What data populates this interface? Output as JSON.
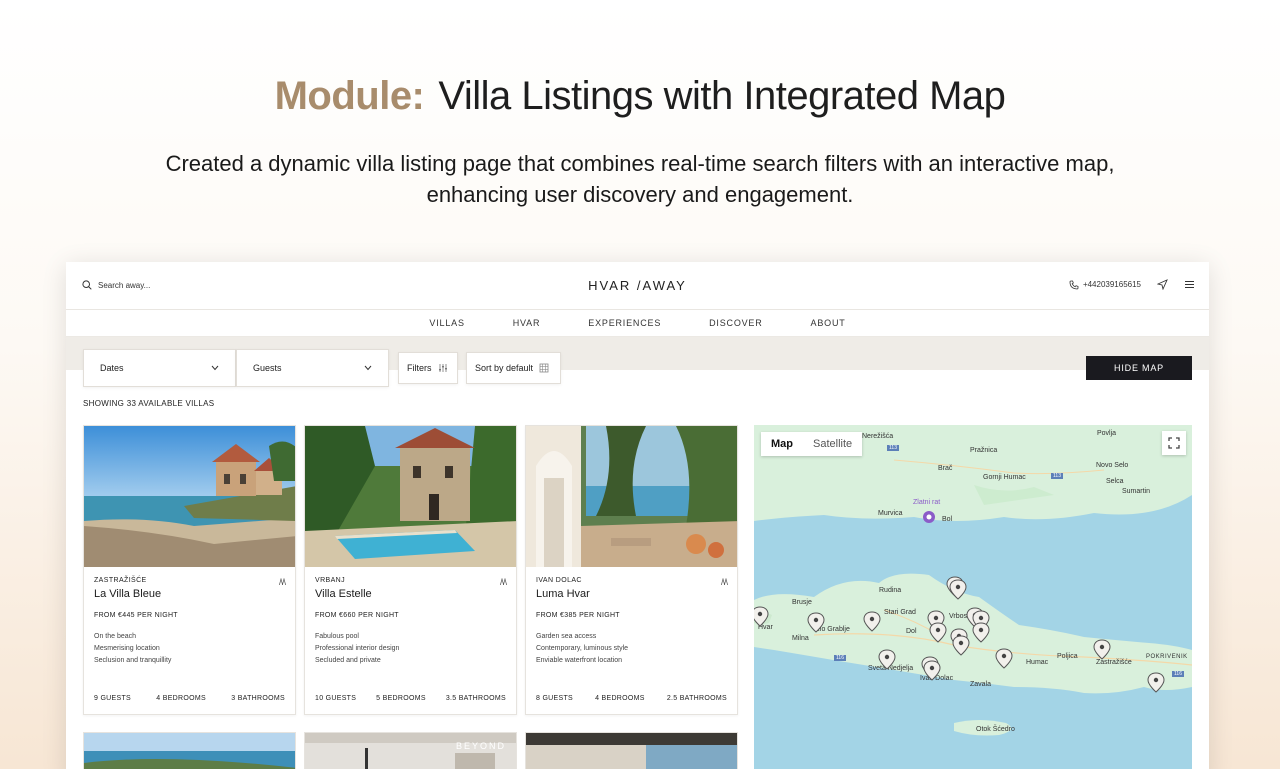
{
  "header": {
    "accent": "Module:",
    "title": "Villa Listings with Integrated Map",
    "description": "Created a dynamic villa listing page that combines real-time search filters with an interactive map, enhancing user discovery and engagement."
  },
  "site": {
    "search_placeholder": "Search away...",
    "logo": "HVAR /AWAY",
    "phone": "+442039165615",
    "nav": [
      "VILLAS",
      "HVAR",
      "EXPERIENCES",
      "DISCOVER",
      "ABOUT"
    ]
  },
  "filters": {
    "dates": "Dates",
    "guests": "Guests",
    "filters": "Filters",
    "sort": "Sort by default",
    "hide_map": "HIDE MAP"
  },
  "results": {
    "showing": "SHOWING 33 AVAILABLE VILLAS"
  },
  "listings": [
    {
      "location": "ZASTRAŽIŠĆE",
      "name": "La Villa Bleue",
      "price": "FROM €445 PER NIGHT",
      "features": [
        "On the beach",
        "Mesmerising location",
        "Seclusion and tranquillity"
      ],
      "guests": "9 GUESTS",
      "bedrooms": "4 BEDROOMS",
      "bathrooms": "3 BATHROOMS"
    },
    {
      "location": "VRBANJ",
      "name": "Villa Estelle",
      "price": "FROM €660 PER NIGHT",
      "features": [
        "Fabulous pool",
        "Professional interior design",
        "Secluded and private"
      ],
      "guests": "10 GUESTS",
      "bedrooms": "5 BEDROOMS",
      "bathrooms": "3.5 BATHROOMS"
    },
    {
      "location": "IVAN DOLAC",
      "name": "Luma Hvar",
      "price": "FROM €385 PER NIGHT",
      "features": [
        "Garden sea access",
        "Contemporary, luminous style",
        "Enviable waterfront location"
      ],
      "guests": "8 GUESTS",
      "bedrooms": "4 BEDROOMS",
      "bathrooms": "2.5 BATHROOMS"
    }
  ],
  "second_row": {
    "brand_overlay": "BEYOND"
  },
  "map": {
    "tab_map": "Map",
    "tab_satellite": "Satellite",
    "labels": {
      "nerezisca": "Nerežišća",
      "povlja": "Povlja",
      "praznica": "Pražnica",
      "brac": "Brač",
      "gornji_humac": "Gornji Humac",
      "novo_selo": "Novo Selo",
      "selca": "Selca",
      "sumartin": "Sumartin",
      "zlatni_rat": "Zlatni rat",
      "murvica": "Murvica",
      "bol": "Bol",
      "rudina": "Rudina",
      "brusje": "Brusje",
      "stari_grad": "Stari Grad",
      "vrboska": "Vrbos...",
      "hvar": "Hvar",
      "velo_grablje": "elo Grablje",
      "milna": "Milna",
      "dol": "Dol",
      "sveta_nedjelja": "Sveta Nedjelja",
      "ivan_dolac": "Ivan Dolac",
      "humac": "Humac",
      "poljica": "Poljica",
      "zastrazisce": "Zastražišće",
      "pokrivenik": "POKRIVENIK",
      "zavala": "Zavala",
      "scedro": "Otok Šćedro",
      "r113a": "113",
      "r113b": "113",
      "r116a": "116",
      "r116b": "116"
    }
  }
}
